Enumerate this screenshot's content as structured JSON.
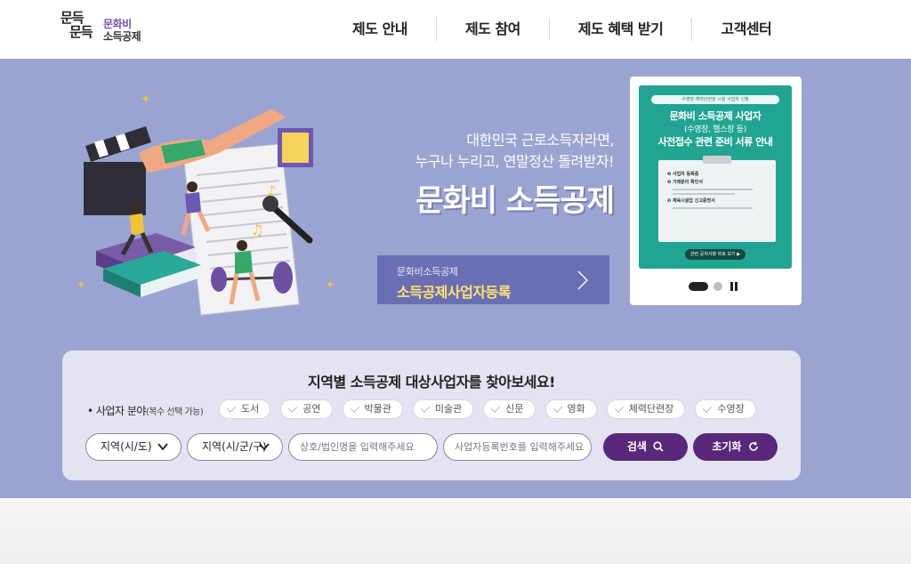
{
  "header": {
    "logo": {
      "mark_line1": "문득",
      "mark_line2": "문득",
      "text_line1": "문화비",
      "text_line2": "소득공제"
    },
    "nav": [
      "제도 안내",
      "제도 참여",
      "제도 혜택 받기",
      "고객센터"
    ]
  },
  "hero": {
    "tagline_line1": "대한민국 근로소득자라면,",
    "tagline_line2": "누구나 누리고, 연말정산 돌려받자!",
    "title": "문화비 소득공제",
    "register_button": {
      "small": "문화비소득공제",
      "big": "소득공제사업자등록"
    }
  },
  "banner": {
    "top_strip": "수영장·체력단련장 시설 사업자 신청",
    "heading1": "문화비 소득공제 사업자",
    "heading2": "(수영장, 헬스장 등)",
    "heading3": "사전접수 관련 준비 서류 안내",
    "doc_items": [
      "사업자 등록증",
      "거래분리 확인서",
      "체육시설업 신고증명서"
    ],
    "button": "관련 공지사항 바로 보기 ▶",
    "slide_index": 1,
    "slide_count": 2,
    "colors": {
      "card_bg": "#22a493",
      "button_bg": "#124b44"
    }
  },
  "search": {
    "title": "지역별 소득공제 대상사업자를 찾아보세요!",
    "category_label": "• 사업자 분야",
    "category_note": "(복수 선택 가능)",
    "categories": [
      "도서",
      "공연",
      "박물관",
      "미술관",
      "신문",
      "영화",
      "체력단련장",
      "수영장"
    ],
    "region1": "지역(시/도)",
    "region2": "지역(시/군/구)",
    "name_placeholder": "상호/법인명을 입력해주세요",
    "bizno_placeholder": "사업자등록번호를 입력해주세요",
    "search_button": "검색",
    "reset_button": "초기화"
  },
  "colors": {
    "hero_bg": "#9ba4d1",
    "accent_purple": "#59287a",
    "register_btn_bg": "#6a6fb4",
    "register_btn_text": "#ffe36e"
  }
}
